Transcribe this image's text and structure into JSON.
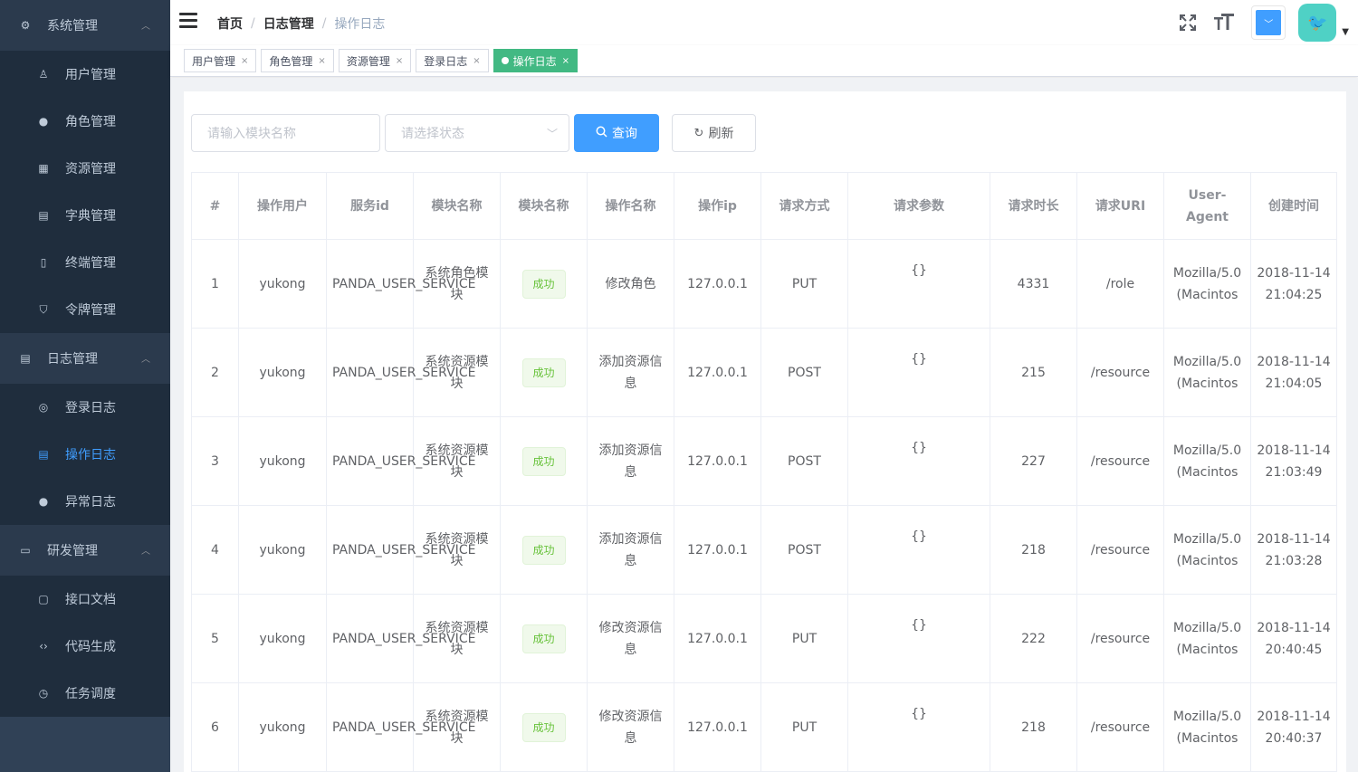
{
  "sidebar": {
    "groups": [
      {
        "label": "系统管理",
        "icon": "gear-icon",
        "items": [
          {
            "label": "用户管理",
            "icon": "user-icon"
          },
          {
            "label": "角色管理",
            "icon": "people-icon"
          },
          {
            "label": "资源管理",
            "icon": "grid-icon"
          },
          {
            "label": "字典管理",
            "icon": "book-icon"
          },
          {
            "label": "终端管理",
            "icon": "phone-icon"
          },
          {
            "label": "令牌管理",
            "icon": "token-icon"
          }
        ]
      },
      {
        "label": "日志管理",
        "icon": "log-icon",
        "items": [
          {
            "label": "登录日志",
            "icon": "login-icon"
          },
          {
            "label": "操作日志",
            "icon": "operation-log-icon"
          },
          {
            "label": "异常日志",
            "icon": "exception-icon"
          }
        ]
      },
      {
        "label": "研发管理",
        "icon": "dev-icon",
        "items": [
          {
            "label": "接口文档",
            "icon": "doc-icon"
          },
          {
            "label": "代码生成",
            "icon": "code-icon"
          },
          {
            "label": "任务调度",
            "icon": "schedule-icon"
          }
        ]
      }
    ],
    "active_item": "操作日志"
  },
  "navbar": {
    "breadcrumb": [
      "首页",
      "日志管理",
      "操作日志"
    ],
    "separator": "/",
    "theme_color": "#409eff"
  },
  "tags": [
    {
      "label": "用户管理",
      "active": false
    },
    {
      "label": "角色管理",
      "active": false
    },
    {
      "label": "资源管理",
      "active": false
    },
    {
      "label": "登录日志",
      "active": false
    },
    {
      "label": "操作日志",
      "active": true
    }
  ],
  "filter": {
    "module_placeholder": "请输入模块名称",
    "status_placeholder": "请选择状态",
    "search_label": "查询",
    "refresh_label": "刷新"
  },
  "table": {
    "headers": [
      "#",
      "操作用户",
      "服务id",
      "模块名称",
      "模块名称",
      "操作名称",
      "操作ip",
      "请求方式",
      "请求参数",
      "请求时长",
      "请求URI",
      "User-Agent",
      "创建时间"
    ],
    "rows": [
      {
        "no": "1",
        "user": "yukong",
        "service": "PANDA_USER_SERVICE",
        "module": "系统角色模块",
        "status": "成功",
        "operation": "修改角色",
        "ip": "127.0.0.1",
        "method": "PUT",
        "params": "{}",
        "duration": "4331",
        "uri": "/role",
        "agent": "Mozilla/5.0 (Macintos",
        "created": "2018-11-14 21:04:25"
      },
      {
        "no": "2",
        "user": "yukong",
        "service": "PANDA_USER_SERVICE",
        "module": "系统资源模块",
        "status": "成功",
        "operation": "添加资源信息",
        "ip": "127.0.0.1",
        "method": "POST",
        "params": "{}",
        "duration": "215",
        "uri": "/resource",
        "agent": "Mozilla/5.0 (Macintos",
        "created": "2018-11-14 21:04:05"
      },
      {
        "no": "3",
        "user": "yukong",
        "service": "PANDA_USER_SERVICE",
        "module": "系统资源模块",
        "status": "成功",
        "operation": "添加资源信息",
        "ip": "127.0.0.1",
        "method": "POST",
        "params": "{}",
        "duration": "227",
        "uri": "/resource",
        "agent": "Mozilla/5.0 (Macintos",
        "created": "2018-11-14 21:03:49"
      },
      {
        "no": "4",
        "user": "yukong",
        "service": "PANDA_USER_SERVICE",
        "module": "系统资源模块",
        "status": "成功",
        "operation": "添加资源信息",
        "ip": "127.0.0.1",
        "method": "POST",
        "params": "{}",
        "duration": "218",
        "uri": "/resource",
        "agent": "Mozilla/5.0 (Macintos",
        "created": "2018-11-14 21:03:28"
      },
      {
        "no": "5",
        "user": "yukong",
        "service": "PANDA_USER_SERVICE",
        "module": "系统资源模块",
        "status": "成功",
        "operation": "修改资源信息",
        "ip": "127.0.0.1",
        "method": "PUT",
        "params": "{}",
        "duration": "222",
        "uri": "/resource",
        "agent": "Mozilla/5.0 (Macintos",
        "created": "2018-11-14 20:40:45"
      },
      {
        "no": "6",
        "user": "yukong",
        "service": "PANDA_USER_SERVICE",
        "module": "系统资源模块",
        "status": "成功",
        "operation": "修改资源信息",
        "ip": "127.0.0.1",
        "method": "PUT",
        "params": "{}",
        "duration": "218",
        "uri": "/resource",
        "agent": "Mozilla/5.0 (Macintos",
        "created": "2018-11-14 20:40:37"
      }
    ]
  }
}
